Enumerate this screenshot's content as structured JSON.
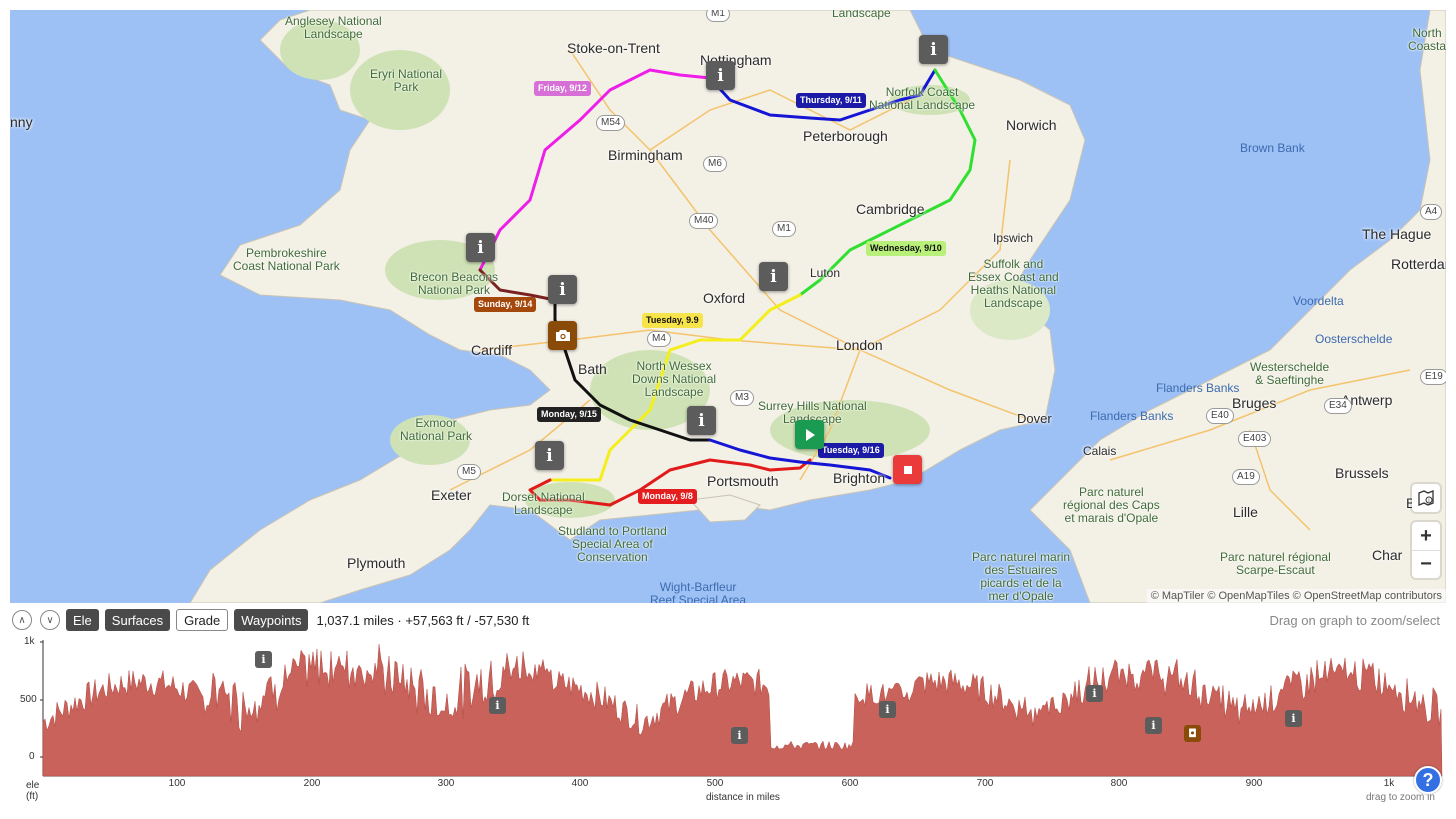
{
  "map": {
    "cities": [
      {
        "name": "Stoke-on-Trent"
      },
      {
        "name": "Nottingham"
      },
      {
        "name": "Birmingham"
      },
      {
        "name": "Peterborough"
      },
      {
        "name": "Norwich"
      },
      {
        "name": "Cambridge"
      },
      {
        "name": "Ipswich"
      },
      {
        "name": "Luton"
      },
      {
        "name": "Oxford"
      },
      {
        "name": "London"
      },
      {
        "name": "Cardiff"
      },
      {
        "name": "Bath"
      },
      {
        "name": "Exeter"
      },
      {
        "name": "Plymouth"
      },
      {
        "name": "Portsmouth"
      },
      {
        "name": "Brighton"
      },
      {
        "name": "Dover"
      },
      {
        "name": "Calais"
      },
      {
        "name": "Lille"
      },
      {
        "name": "Bruges"
      },
      {
        "name": "Antwerp"
      },
      {
        "name": "Brussels"
      },
      {
        "name": "The Hague"
      },
      {
        "name": "Rotterdam"
      },
      {
        "name": "nny"
      },
      {
        "name": "Belgi"
      },
      {
        "name": "Char"
      }
    ],
    "parks": [
      "Anglesey National\nLandscape",
      "Eryri National\nPark",
      "Pembrokeshire\nCoast National Park",
      "Brecon Beacons\nNational Park",
      "Norfolk Coast\nNational Landscape",
      "Suffolk and\nEssex Coast and\nHeaths National\nLandscape",
      "North Wessex\nDowns National\nLandscape",
      "Surrey Hills National\nLandscape",
      "Exmoor\nNational Park",
      "Dorset National\nLandscape",
      "Studland to Portland\nSpecial Area of\nConservation",
      "Westerschelde\n& Saeftinghe",
      "Parc naturel\nrégional des Caps\net marais d'Opale",
      "Parc naturel marin\ndes Estuaires\npicards et de la\nmer d'Opale",
      "Parc naturel régional\nScarpe-Escaut",
      "Landscape",
      "North\nCoasta"
    ],
    "water": [
      "Brown Bank",
      "Voordelta",
      "Oosterschelde",
      "Flanders Banks",
      "Flanders Banks",
      "Wight-Barfleur\nReef Special Area"
    ],
    "roads": [
      "M1",
      "M54",
      "M6",
      "M40",
      "M1",
      "M4",
      "M3",
      "M5",
      "A4",
      "E19",
      "E40",
      "E34",
      "E403",
      "A19"
    ],
    "day_labels": [
      {
        "text": "Friday, 9/12",
        "bg": "#d66fd6",
        "fg": "#ffffff"
      },
      {
        "text": "Thursday, 9/11",
        "bg": "#1a1aa6",
        "fg": "#ffffff"
      },
      {
        "text": "Wednesday, 9/10",
        "bg": "#b9f07a",
        "fg": "#111111"
      },
      {
        "text": "Sunday, 9/14",
        "bg": "#a5480b",
        "fg": "#ffffff"
      },
      {
        "text": "Tuesday, 9.9",
        "bg": "#f7e34a",
        "fg": "#111111"
      },
      {
        "text": "Monday, 9/15",
        "bg": "#222222",
        "fg": "#ffffff"
      },
      {
        "text": "Tuesday, 9/16",
        "bg": "#1a1aa6",
        "fg": "#ffffff"
      },
      {
        "text": "Monday, 9/8",
        "bg": "#e41e1e",
        "fg": "#ffffff"
      }
    ],
    "attribution": "© MapTiler © OpenMapTiles © OpenStreetMap contributors",
    "zoom_in": "+",
    "zoom_out": "−"
  },
  "toolbar": {
    "collapse_up": "∧",
    "collapse_down": "∨",
    "buttons": [
      "Ele",
      "Surfaces",
      "Grade",
      "Waypoints"
    ],
    "stats": "1,037.1 miles · +57,563 ft / -57,530 ft",
    "hint": "Drag on graph to zoom/select"
  },
  "elevation": {
    "y_ticks": [
      "1k",
      "500",
      "0"
    ],
    "x_ticks": [
      "100",
      "200",
      "300",
      "400",
      "500",
      "600",
      "700",
      "800",
      "900",
      "1k"
    ],
    "y_axis_label": "ele\n(ft)",
    "x_axis_label": "distance in miles",
    "zoom_hint": "drag to zoom in",
    "help_label": "?",
    "fill_color": "#c9625a"
  }
}
